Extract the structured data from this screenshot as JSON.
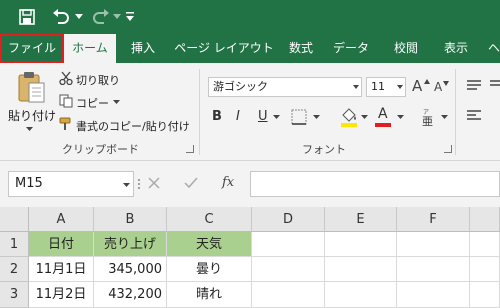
{
  "quick_access": {
    "save_icon": "save-icon",
    "undo_icon": "undo-icon",
    "redo_icon": "redo-icon",
    "customize_icon": "customize-qat-icon"
  },
  "tabs": [
    {
      "label": "ファイル"
    },
    {
      "label": "ホーム"
    },
    {
      "label": "挿入"
    },
    {
      "label": "ページ レイアウト"
    },
    {
      "label": "数式"
    },
    {
      "label": "データ"
    },
    {
      "label": "校閲"
    },
    {
      "label": "表示"
    },
    {
      "label": "ヘ"
    }
  ],
  "clipboard": {
    "paste_label": "貼り付け",
    "cut_label": "切り取り",
    "copy_label": "コピー",
    "format_painter_label": "書式のコピー/貼り付け",
    "group_label": "クリップボード"
  },
  "font": {
    "font_name": "游ゴシック",
    "font_size": "11",
    "bold": "B",
    "italic": "I",
    "underline": "U",
    "grow": "A",
    "shrink": "A",
    "font_color_letter": "A",
    "group_label": "フォント",
    "font_color": "#e02020",
    "fill_color": "#ffe500"
  },
  "formula_bar": {
    "name_box": "M15",
    "fx_label": "fx",
    "formula": ""
  },
  "sheet": {
    "columns": [
      "A",
      "B",
      "C",
      "D",
      "E",
      "F"
    ],
    "rows": [
      {
        "num": "1",
        "cells": [
          "日付",
          "売り上げ",
          "天気"
        ]
      },
      {
        "num": "2",
        "cells": [
          "11月1日",
          "345,000",
          "曇り"
        ]
      },
      {
        "num": "3",
        "cells": [
          "11月2日",
          "432,200",
          "晴れ"
        ]
      }
    ],
    "header_fill": "#a9d08e"
  },
  "brand_color": "#217346"
}
